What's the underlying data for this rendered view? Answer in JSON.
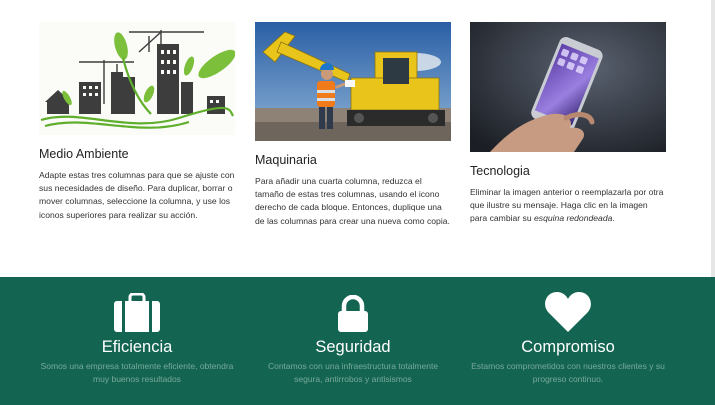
{
  "columns": [
    {
      "title": "Medio Ambiente",
      "text": "Adapte estas tres columnas para que se ajuste con sus necesidades de diseño. Para duplicar, borrar o mover columnas, seleccione la columna, y use los iconos superiores para realizar su acción.",
      "image": "green-city-illustration"
    },
    {
      "title": "Maquinaria",
      "text": "Para añadir una cuarta columna, reduzca el tamaño de estas tres columnas, usando el icono derecho de cada bloque. Entonces, duplique una de las columnas para crear una nueva como copia.",
      "image": "excavator-worker-photo"
    },
    {
      "title": "Tecnologia",
      "text_before": "Eliminar la imagen anterior o reemplazarla por otra que ilustre su mensaje. Haga clic en la imagen para cambiar su ",
      "text_italic": "esquina redondeada",
      "text_after": ".",
      "image": "hand-holding-smartphone-photo"
    }
  ],
  "features": [
    {
      "icon": "briefcase-icon",
      "title": "Eficiencia",
      "text": "Somos una empresa totalmente eficiente, obtendra muy buenos resultados"
    },
    {
      "icon": "lock-icon",
      "title": "Seguridad",
      "text": "Contamos con una infraestructura totalmente segura, antirrobos y antisismos"
    },
    {
      "icon": "heart-icon",
      "title": "Compromiso",
      "text": "Estamos comprometidos con nuestros clientes y su progreso continuo."
    }
  ],
  "colors": {
    "band_background": "#136552",
    "band_text": "#79a89b",
    "heading": "#222222"
  }
}
